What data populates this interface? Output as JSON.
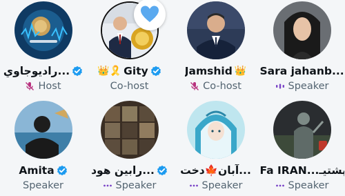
{
  "accent_color": "#1d9bf0",
  "mic_muted_color": "#b8327f",
  "participants": [
    {
      "name": "راديوجاوي...",
      "badge": "",
      "verified": true,
      "role": "Host",
      "role_icon": "mic-muted-icon",
      "reaction": ""
    },
    {
      "name": "Gity",
      "badge": "👑🎗️",
      "verified": true,
      "role": "Co-host",
      "role_icon": "",
      "reaction": "heart-icon"
    },
    {
      "name": "Jamshid",
      "badge": "👑",
      "verified": false,
      "role": "Co-host",
      "role_icon": "mic-muted-icon",
      "reaction": ""
    },
    {
      "name": "Sara jahanb...",
      "badge": "",
      "verified": false,
      "role": "Speaker",
      "role_icon": "speaking-bars-icon",
      "reaction": ""
    },
    {
      "name": "Amita",
      "badge": "",
      "verified": true,
      "role": "Speaker",
      "role_icon": "",
      "reaction": ""
    },
    {
      "name": "رابين هود...",
      "badge": "",
      "verified": true,
      "role": "Speaker",
      "role_icon": "speaking-dots-icon",
      "reaction": ""
    },
    {
      "name": "آبان🍁دخت...",
      "badge": "",
      "verified": false,
      "role": "Speaker",
      "role_icon": "speaking-dots-icon",
      "reaction": ""
    },
    {
      "name": "Fa IRAN...پشتيـ",
      "badge": "",
      "verified": false,
      "role": "Speaker",
      "role_icon": "speaking-dots-icon",
      "reaction": ""
    }
  ]
}
